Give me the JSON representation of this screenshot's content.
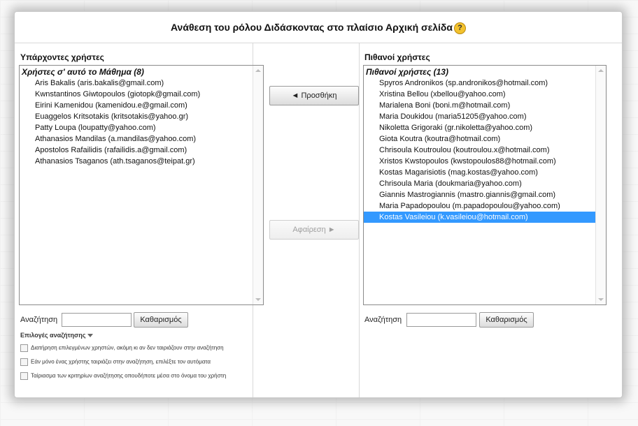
{
  "dialog": {
    "title": "Ανάθεση του ρόλου Διδάσκοντας στο πλαίσιο Αρχική σελίδα",
    "help_icon": "?"
  },
  "existing_users": {
    "header": "Υπάρχοντες χρήστες",
    "group_label": "Χρήστες σ' αυτό το Μάθημα (8)",
    "items": [
      "Aris Bakalis (aris.bakalis@gmail.com)",
      "Kwnstantinos Giwtopoulos (giotopk@gmail.com)",
      "Eirini Kamenidou (kamenidou.e@gmail.com)",
      "Euaggelos Kritsotakis (kritsotakis@yahoo.gr)",
      "Patty Loupa (loupatty@yahoo.com)",
      "Athanasios Mandilas (a.mandilas@yahoo.com)",
      "Apostolos Rafailidis (rafailidis.a@gmail.com)",
      "Athanasios Tsaganos (ath.tsaganos@teipat.gr)"
    ],
    "search_label": "Αναζήτηση",
    "search_value": "",
    "clear_button": "Καθαρισμός"
  },
  "potential_users": {
    "header": "Πιθανοί χρήστες",
    "group_label": "Πιθανοί χρήστες (13)",
    "items": [
      "Spyros Andronikos (sp.andronikos@hotmail.com)",
      "Xristina Bellou (xbellou@yahoo.com)",
      "Marialena Boni (boni.m@hotmail.com)",
      "Maria Doukidou (maria51205@yahoo.com)",
      "Nikoletta Grigoraki (gr.nikoletta@yahoo.com)",
      "Giota Koutra (koutra@hotmail.com)",
      "Chrisoula Koutroulou (koutroulou.x@hotmail.com)",
      "Xristos Kwstopoulos (kwstopoulos88@hotmail.com)",
      "Kostas Magarisiotis (mag.kostas@yahoo.com)",
      "Chrisoula Maria (doukmaria@yahoo.com)",
      "Giannis Mastrogiannis (mastro.giannis@gmail.com)",
      "Maria Papadopoulou (m.papadopoulou@yahoo.com)",
      "Kostas Vasileiou (k.vasileiou@hotmail.com)"
    ],
    "selected_index": 12,
    "search_label": "Αναζήτηση",
    "search_value": "",
    "clear_button": "Καθαρισμός"
  },
  "actions": {
    "add_button": "◄ Προσθήκη",
    "remove_button": "Αφαίρεση ►"
  },
  "search_options": {
    "toggle_label": "Επιλογές αναζήτησης",
    "options": [
      "Διατήρηση επιλεγμένων χρηστών, ακόμη κι αν δεν ταιριάζουν στην αναζήτηση",
      "Εάν μόνο ένας χρήστης ταιριάζει στην αναζήτηση, επιλέξτε τον αυτόματα",
      "Ταίριασμα των κριτηρίων αναζήτησης οπουδήποτε μέσα στο όνομα του χρήστη"
    ]
  }
}
